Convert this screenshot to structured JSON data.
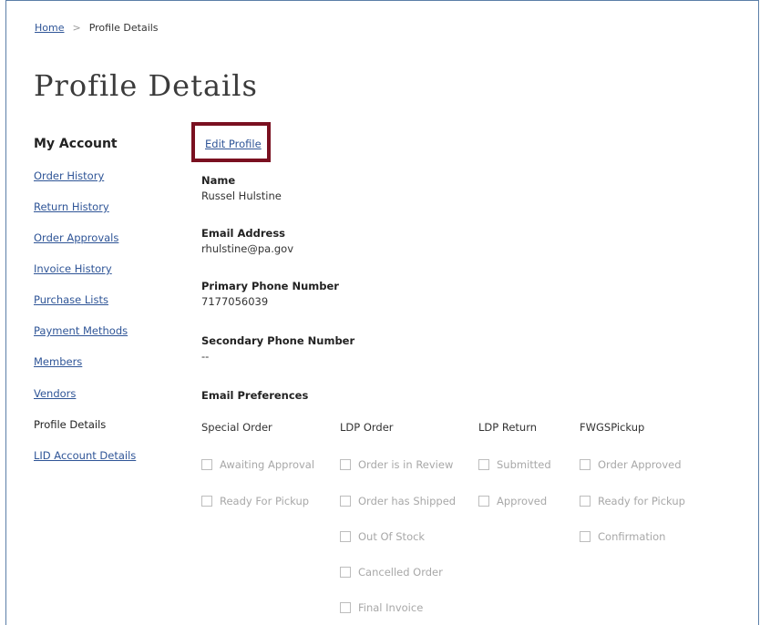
{
  "breadcrumb": {
    "home": "Home",
    "separator": ">",
    "current": "Profile Details"
  },
  "page_title": "Profile Details",
  "sidebar": {
    "title": "My Account",
    "items": [
      {
        "label": "Order History"
      },
      {
        "label": "Return History"
      },
      {
        "label": "Order Approvals"
      },
      {
        "label": "Invoice History"
      },
      {
        "label": "Purchase Lists"
      },
      {
        "label": "Payment Methods"
      },
      {
        "label": "Members"
      },
      {
        "label": "Vendors"
      },
      {
        "label": "Profile Details"
      },
      {
        "label": "LID Account Details"
      }
    ]
  },
  "edit_profile": "Edit Profile",
  "profile": {
    "name_label": "Name",
    "name_value": "Russel Hulstine",
    "email_label": "Email Address",
    "email_value": "rhulstine@pa.gov",
    "primary_label": "Primary Phone Number",
    "primary_value": "7177056039",
    "secondary_label": "Secondary Phone Number",
    "secondary_value": "--"
  },
  "email_preferences": {
    "label": "Email Preferences",
    "columns": [
      {
        "title": "Special Order",
        "options": [
          "Awaiting Approval",
          "Ready For Pickup"
        ]
      },
      {
        "title": "LDP Order",
        "options": [
          "Order is in Review",
          "Order has Shipped",
          "Out Of Stock",
          "Cancelled Order",
          "Final Invoice"
        ]
      },
      {
        "title": "LDP Return",
        "options": [
          "Submitted",
          "Approved"
        ]
      },
      {
        "title": "FWGSPickup",
        "options": [
          "Order Approved",
          "Ready for Pickup",
          "Confirmation"
        ]
      }
    ]
  },
  "colors": {
    "link": "#2f5597",
    "highlight_border": "#7a1020",
    "frame_border": "#5b7fa8"
  }
}
